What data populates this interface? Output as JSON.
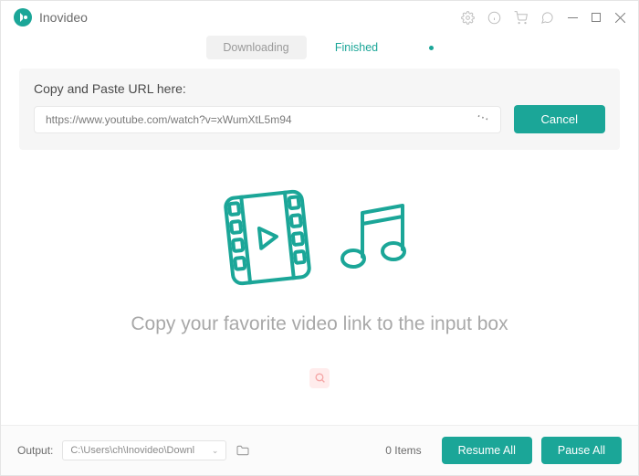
{
  "app": {
    "name": "Inovideo"
  },
  "tabs": {
    "downloading": "Downloading",
    "finished": "Finished"
  },
  "url_section": {
    "label": "Copy and Paste URL here:",
    "value": "https://www.youtube.com/watch?v=xWumXtL5m94",
    "cancel": "Cancel"
  },
  "main": {
    "empty_text": "Copy your favorite video link to the input box"
  },
  "footer": {
    "output_label": "Output:",
    "output_path": "C:\\Users\\ch\\Inovideo\\Downl",
    "items_count": "0 Items",
    "resume": "Resume All",
    "pause": "Pause All"
  }
}
